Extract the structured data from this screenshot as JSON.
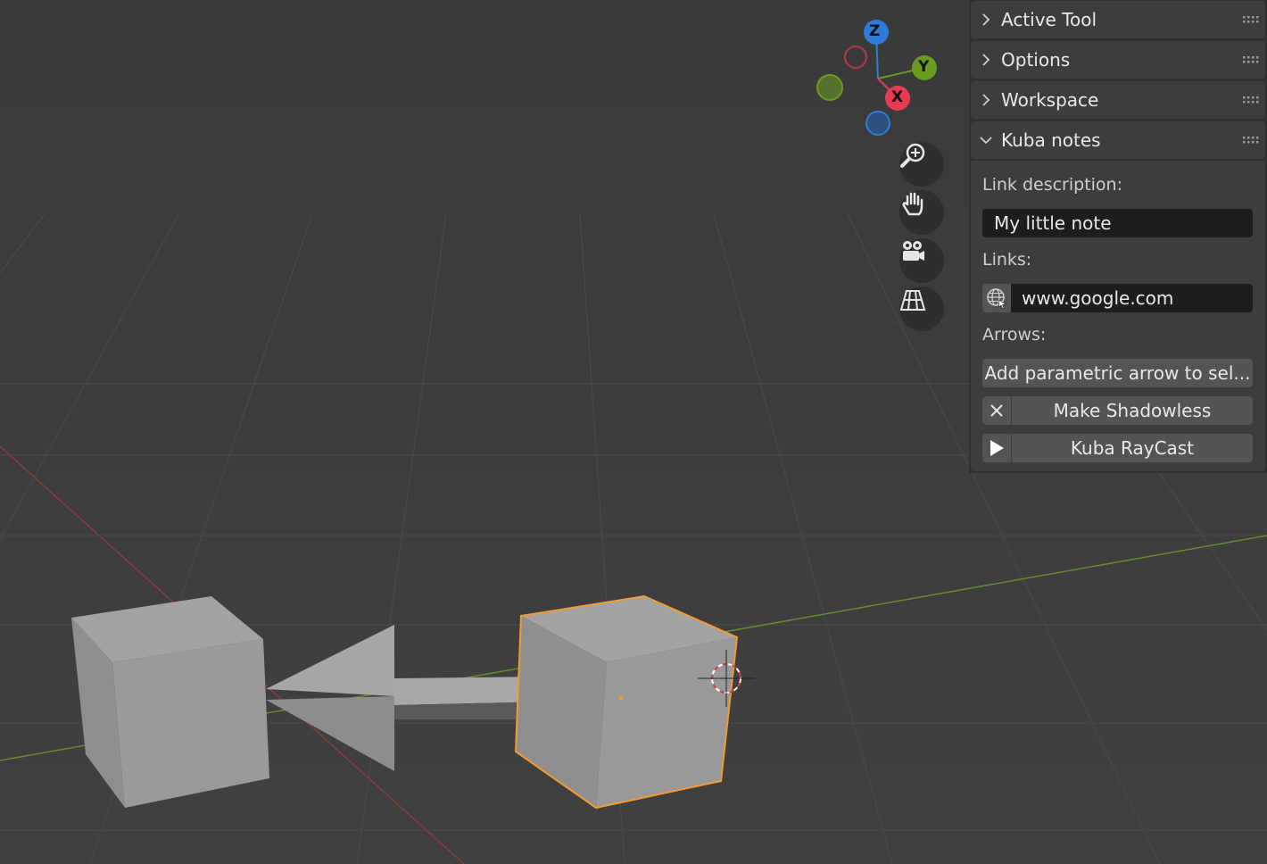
{
  "gizmo": {
    "axes": [
      {
        "label": "Z",
        "color": "#2f7bd8"
      },
      {
        "label": "Y",
        "color": "#6a9a1f"
      },
      {
        "label": "X",
        "color": "#e83a55"
      }
    ]
  },
  "nav_buttons": [
    {
      "icon": "zoom-icon"
    },
    {
      "icon": "hand-pan-icon"
    },
    {
      "icon": "camera-icon"
    },
    {
      "icon": "perspective-grid-icon"
    }
  ],
  "sidebar": {
    "panels": [
      {
        "title": "Active Tool",
        "expanded": false
      },
      {
        "title": "Options",
        "expanded": false
      },
      {
        "title": "Workspace",
        "expanded": false
      },
      {
        "title": "Kuba notes",
        "expanded": true
      }
    ],
    "kuba_notes": {
      "link_description_label": "Link description:",
      "link_description_value": "My little note",
      "links_label": "Links:",
      "link_value": "www.google.com",
      "arrows_label": "Arrows:",
      "add_arrow_button": "Add parametric arrow to sel...",
      "shadowless_button": "Make Shadowless",
      "raycast_button": "Kuba RayCast"
    }
  },
  "colors": {
    "selection_outline": "#f29b35",
    "x_axis_line": "#8a3a3f",
    "y_axis_line": "#6b8a2e",
    "viewport_bg": "#3d3d3d",
    "sidebar_bg": "#303030"
  }
}
